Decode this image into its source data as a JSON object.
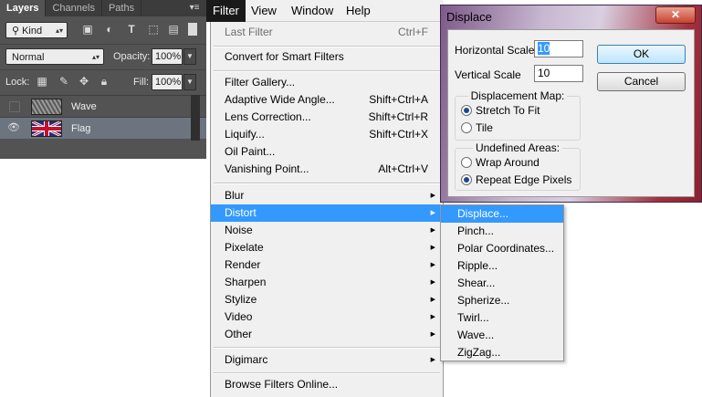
{
  "layers_panel": {
    "tabs": [
      "Layers",
      "Channels",
      "Paths"
    ],
    "filter_kind": "Kind",
    "blend_mode": "Normal",
    "opacity_label": "Opacity:",
    "opacity_value": "100%",
    "lock_label": "Lock:",
    "fill_label": "Fill:",
    "fill_value": "100%",
    "layers": [
      {
        "name": "Wave",
        "visible": false
      },
      {
        "name": "Flag",
        "visible": true
      }
    ]
  },
  "menubar": {
    "items": [
      "Filter",
      "View",
      "Window",
      "Help"
    ]
  },
  "filter_menu": {
    "last_filter": {
      "label": "Last Filter",
      "shortcut": "Ctrl+F"
    },
    "convert_smart": "Convert for Smart Filters",
    "filter_gallery": "Filter Gallery...",
    "adaptive_wide_angle": {
      "label": "Adaptive Wide Angle...",
      "shortcut": "Shift+Ctrl+A"
    },
    "lens_correction": {
      "label": "Lens Correction...",
      "shortcut": "Shift+Ctrl+R"
    },
    "liquify": {
      "label": "Liquify...",
      "shortcut": "Shift+Ctrl+X"
    },
    "oil_paint": "Oil Paint...",
    "vanishing_point": {
      "label": "Vanishing Point...",
      "shortcut": "Alt+Ctrl+V"
    },
    "submenus": [
      "Blur",
      "Distort",
      "Noise",
      "Pixelate",
      "Render",
      "Sharpen",
      "Stylize",
      "Video",
      "Other"
    ],
    "digimarc": "Digimarc",
    "browse_online": "Browse Filters Online..."
  },
  "distort_menu": {
    "items": [
      "Displace...",
      "Pinch...",
      "Polar Coordinates...",
      "Ripple...",
      "Shear...",
      "Spherize...",
      "Twirl...",
      "Wave...",
      "ZigZag..."
    ]
  },
  "displace_dialog": {
    "title": "Displace",
    "close_glyph": "✕",
    "horizontal_label": "Horizontal Scale",
    "horizontal_value": "10",
    "vertical_label": "Vertical Scale",
    "vertical_value": "10",
    "map_group": "Displacement Map:",
    "stretch_to_fit": "Stretch To Fit",
    "tile": "Tile",
    "undefined_group": "Undefined Areas:",
    "wrap_around": "Wrap Around",
    "repeat_edge": "Repeat Edge Pixels",
    "ok": "OK",
    "cancel": "Cancel"
  },
  "colors": {
    "highlight": "#3399ff",
    "panel_bg": "#535353"
  }
}
